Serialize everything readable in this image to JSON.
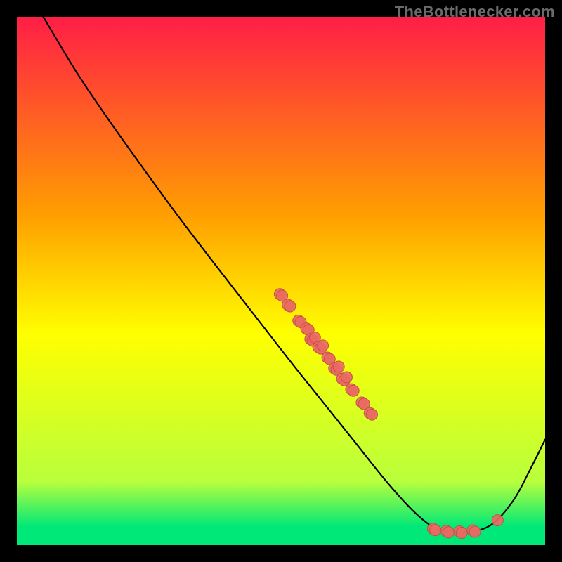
{
  "attribution": "TheBottlenecker.com",
  "colors": {
    "red": "#ff1e46",
    "orange": "#ffa000",
    "yellow": "#ffff00",
    "lime": "#b8ff3c",
    "green": "#00e878",
    "curve": "#000000",
    "dot_fill": "#e96a63",
    "dot_stroke": "#c44f48"
  },
  "chart_data": {
    "type": "line",
    "title": "",
    "xlabel": "",
    "ylabel": "",
    "xlim": [
      0,
      100
    ],
    "ylim": [
      0,
      100
    ],
    "gradient_stops": [
      {
        "offset": 0.0,
        "key": "red"
      },
      {
        "offset": 0.38,
        "key": "orange"
      },
      {
        "offset": 0.6,
        "key": "yellow"
      },
      {
        "offset": 0.88,
        "key": "lime"
      },
      {
        "offset": 0.965,
        "key": "green"
      },
      {
        "offset": 1.0,
        "key": "green"
      }
    ],
    "curve": [
      {
        "x": 5.0,
        "y": 100.0
      },
      {
        "x": 11.0,
        "y": 90.0
      },
      {
        "x": 16.0,
        "y": 82.5
      },
      {
        "x": 22.0,
        "y": 74.0
      },
      {
        "x": 30.0,
        "y": 63.0
      },
      {
        "x": 38.0,
        "y": 52.5
      },
      {
        "x": 45.0,
        "y": 43.5
      },
      {
        "x": 52.0,
        "y": 34.5
      },
      {
        "x": 58.0,
        "y": 27.0
      },
      {
        "x": 64.0,
        "y": 19.5
      },
      {
        "x": 70.0,
        "y": 12.0
      },
      {
        "x": 75.0,
        "y": 6.5
      },
      {
        "x": 79.0,
        "y": 3.3
      },
      {
        "x": 82.0,
        "y": 2.6
      },
      {
        "x": 86.0,
        "y": 2.6
      },
      {
        "x": 90.0,
        "y": 4.0
      },
      {
        "x": 94.0,
        "y": 8.5
      },
      {
        "x": 97.0,
        "y": 14.0
      },
      {
        "x": 100.0,
        "y": 20.0
      }
    ],
    "clusters": [
      {
        "x": 50.0,
        "y": 47.5,
        "n": 2
      },
      {
        "x": 51.5,
        "y": 45.5,
        "n": 2
      },
      {
        "x": 53.5,
        "y": 42.5,
        "n": 2
      },
      {
        "x": 55.0,
        "y": 41.0,
        "n": 2
      },
      {
        "x": 56.0,
        "y": 39.0,
        "n": 3
      },
      {
        "x": 57.5,
        "y": 37.5,
        "n": 3
      },
      {
        "x": 59.0,
        "y": 35.5,
        "n": 2
      },
      {
        "x": 60.5,
        "y": 33.5,
        "n": 3
      },
      {
        "x": 62.0,
        "y": 31.5,
        "n": 3
      },
      {
        "x": 63.5,
        "y": 29.5,
        "n": 2
      },
      {
        "x": 65.5,
        "y": 27.0,
        "n": 2
      },
      {
        "x": 67.0,
        "y": 25.0,
        "n": 2
      },
      {
        "x": 79.0,
        "y": 3.1,
        "n": 2
      },
      {
        "x": 81.5,
        "y": 2.7,
        "n": 2
      },
      {
        "x": 84.0,
        "y": 2.6,
        "n": 2
      },
      {
        "x": 86.5,
        "y": 2.8,
        "n": 2
      },
      {
        "x": 91.0,
        "y": 4.7,
        "n": 1
      }
    ],
    "dot_radius": 8
  }
}
